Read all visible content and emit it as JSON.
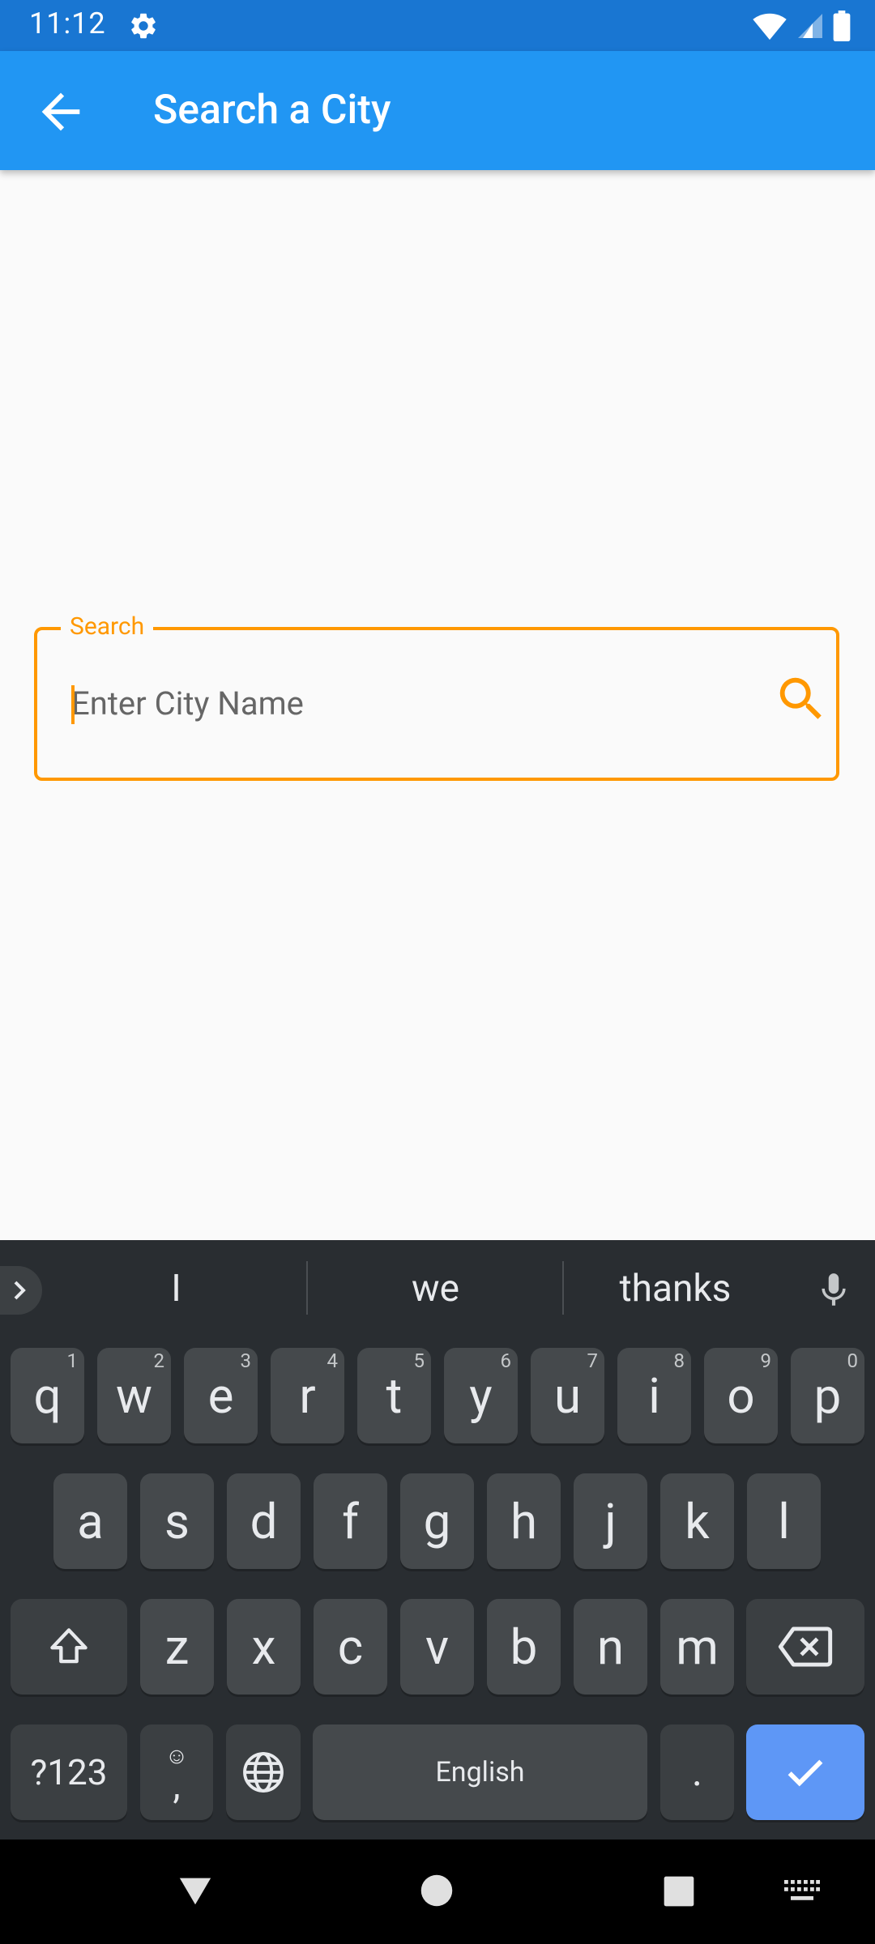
{
  "status_bar": {
    "time": "11:12"
  },
  "app_bar": {
    "title": "Search a City"
  },
  "search": {
    "label": "Search",
    "placeholder": "Enter City Name",
    "value": ""
  },
  "keyboard": {
    "suggestions": [
      "I",
      "we",
      "thanks"
    ],
    "row1": [
      {
        "key": "q",
        "hint": "1"
      },
      {
        "key": "w",
        "hint": "2"
      },
      {
        "key": "e",
        "hint": "3"
      },
      {
        "key": "r",
        "hint": "4"
      },
      {
        "key": "t",
        "hint": "5"
      },
      {
        "key": "y",
        "hint": "6"
      },
      {
        "key": "u",
        "hint": "7"
      },
      {
        "key": "i",
        "hint": "8"
      },
      {
        "key": "o",
        "hint": "9"
      },
      {
        "key": "p",
        "hint": "0"
      }
    ],
    "row2": [
      "a",
      "s",
      "d",
      "f",
      "g",
      "h",
      "j",
      "k",
      "l"
    ],
    "row3": [
      "z",
      "x",
      "c",
      "v",
      "b",
      "n",
      "m"
    ],
    "symbols_label": "?123",
    "comma": ",",
    "space_label": "English",
    "period": "."
  },
  "colors": {
    "status_bar": "#1976d2",
    "app_bar": "#2196f3",
    "accent": "#ff9800",
    "keyboard_bg": "#292d31",
    "key_bg": "#45494c",
    "enter_key": "#5e97f6"
  }
}
